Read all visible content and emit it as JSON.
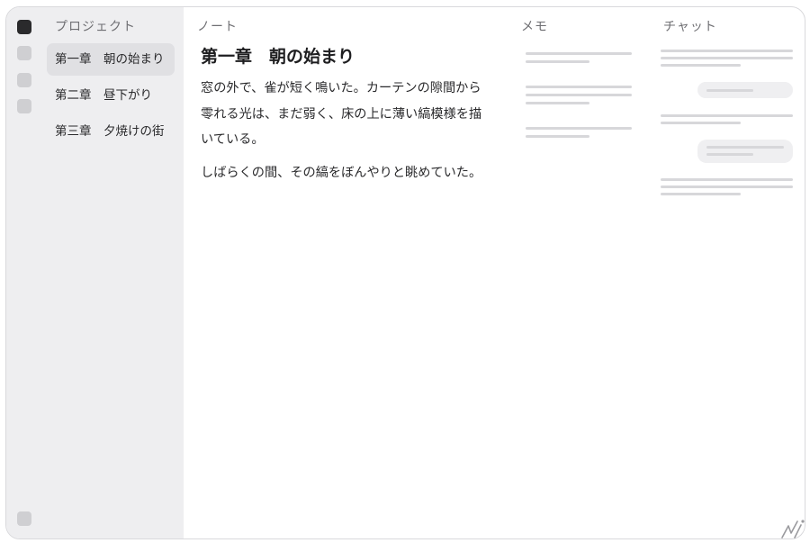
{
  "columns": {
    "project": "プロジェクト",
    "note": "ノート",
    "memo": "メモ",
    "chat": "チャット"
  },
  "sidebar": {
    "items": [
      {
        "label": "第一章　朝の始まり",
        "selected": true
      },
      {
        "label": "第二章　昼下がり",
        "selected": false
      },
      {
        "label": "第三章　夕焼けの街",
        "selected": false
      }
    ]
  },
  "note": {
    "title": "第一章　朝の始まり",
    "paragraphs": [
      "窓の外で、雀が短く鳴いた。カーテンの隙間から零れる光は、まだ弱く、床の上に薄い縞模様を描いている。",
      "しばらくの間、その縞をぼんやりと眺めていた。"
    ]
  },
  "colors": {
    "rail_active": "#2a2a2c",
    "rail_inactive": "#cfcfd2",
    "sidebar_bg": "#eeeef0",
    "selected_bg": "#e0e0e3",
    "skeleton": "#d7d7da"
  }
}
